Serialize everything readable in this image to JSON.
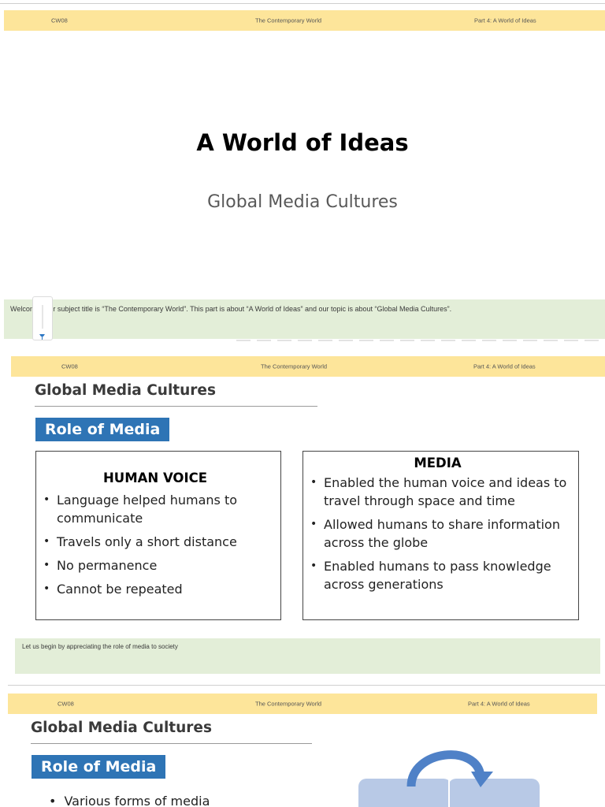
{
  "slides": [
    {
      "header": {
        "left": "CW08",
        "center": "The Contemporary World",
        "right": "Part 4: A World of Ideas"
      },
      "title": "A World of Ideas",
      "subtitle": "Global Media Cultures",
      "notes": "Welcome! Our subject title is “The Contemporary World”. This part is about “A World of Ideas” and our topic is about “Global Media Cultures”."
    },
    {
      "header": {
        "left": "CW08",
        "center": "The Contemporary World",
        "right": "Part 4: A World of Ideas"
      },
      "heading": "Global Media Cultures",
      "badge": "Role of Media",
      "panels": [
        {
          "title": "HUMAN VOICE",
          "bullets": [
            "Language helped humans to communicate",
            "Travels only a short distance",
            "No permanence",
            "Cannot be repeated"
          ]
        },
        {
          "title": "MEDIA",
          "bullets": [
            "Enabled the human voice and ideas to travel through space and time",
            "Allowed humans to share information across the globe",
            "Enabled humans to pass knowledge across generations"
          ]
        }
      ],
      "bullet_glyph": "•",
      "notes": "Let us begin by appreciating the role of media to society"
    },
    {
      "header": {
        "left": "CW08",
        "center": "The Contemporary World",
        "right": "Part 4: A World of Ideas"
      },
      "heading": "Global Media Cultures",
      "badge": "Role of Media",
      "bullet_glyph": "•",
      "bullets": [
        "Various forms of media"
      ]
    }
  ],
  "colors": {
    "header_band": "#fde59a",
    "notes_band": "#e3eed8",
    "badge": "#2e74b5",
    "diagram_box": "#b8c9e6",
    "diagram_arrow": "#4f81c7"
  },
  "icons": {
    "narration_widget": "slider-icon"
  }
}
